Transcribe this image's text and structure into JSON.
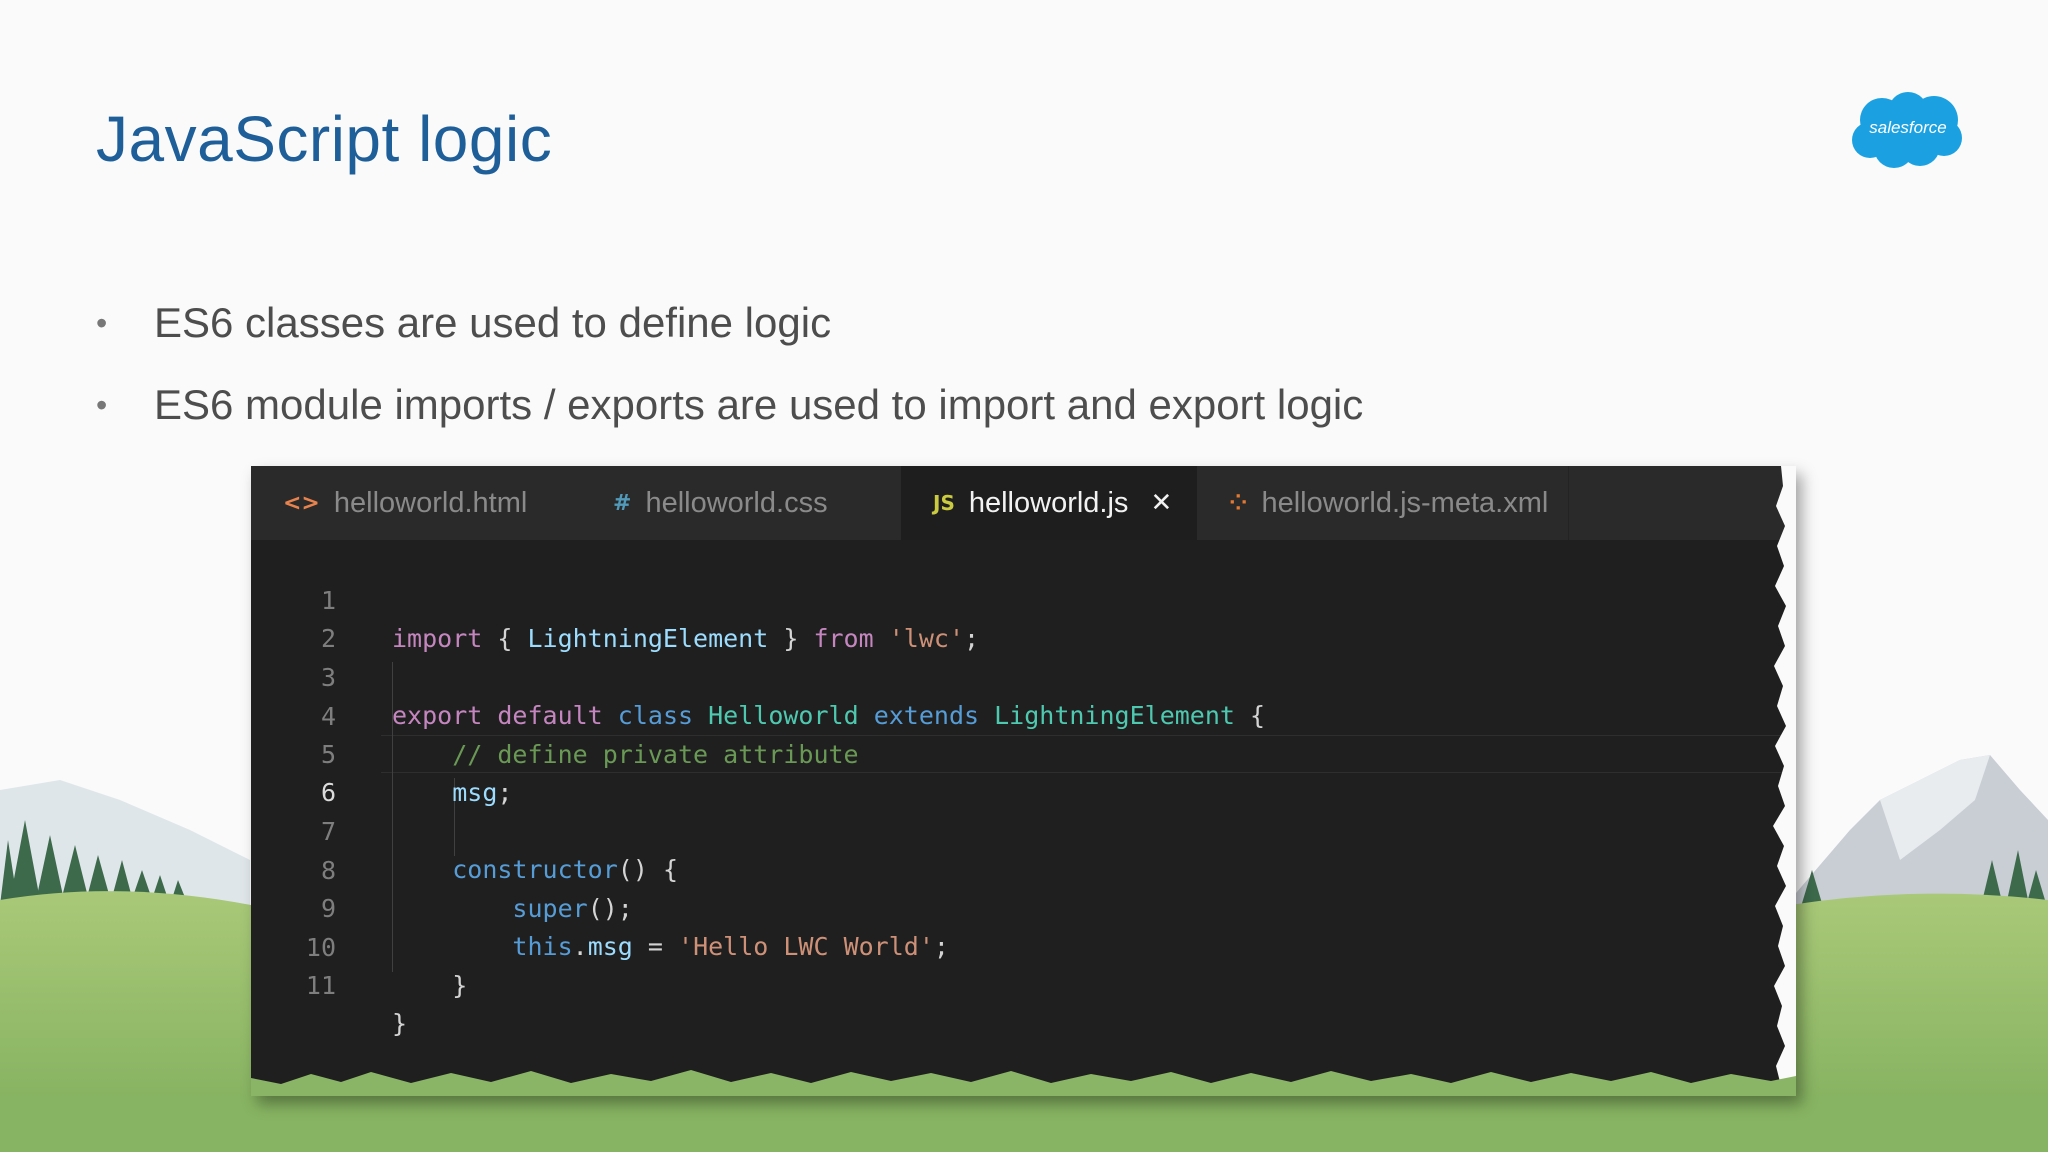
{
  "slide": {
    "title": "JavaScript logic",
    "bullets": [
      "ES6 classes are used to define logic",
      "ES6 module imports / exports are used to import and export logic"
    ],
    "logo_text": "salesforce"
  },
  "editor": {
    "tabs": [
      {
        "label": "helloworld.html",
        "icon": "<>",
        "icon_name": "html-file-icon",
        "icon_color": "#e8834e",
        "active": false
      },
      {
        "label": "helloworld.css",
        "icon": "#",
        "icon_name": "css-file-icon",
        "icon_color": "#519aba",
        "active": false
      },
      {
        "label": "helloworld.js",
        "icon": "JS",
        "icon_name": "js-file-icon",
        "icon_color": "#cbcb41",
        "active": true,
        "close": "✕"
      },
      {
        "label": "helloworld.js-meta.xml",
        "icon": "⁘",
        "icon_name": "xml-file-icon",
        "icon_color": "#e37933",
        "active": false
      }
    ],
    "line_numbers": [
      "1",
      "2",
      "3",
      "4",
      "5",
      "6",
      "7",
      "8",
      "9",
      "10",
      "11"
    ],
    "current_line": "6",
    "code": [
      "import { LightningElement } from 'lwc';",
      "",
      "export default class Helloworld extends LightningElement {",
      "    // define private attribute",
      "    msg;",
      "",
      "    constructor() {",
      "        super();",
      "        this.msg = 'Hello LWC World';",
      "    }",
      "}"
    ]
  },
  "colors": {
    "title": "#1f5f99",
    "logo": "#1ba1e2",
    "editor_bg": "#1f1f1f",
    "tabbar_bg": "#2a2a2a"
  }
}
